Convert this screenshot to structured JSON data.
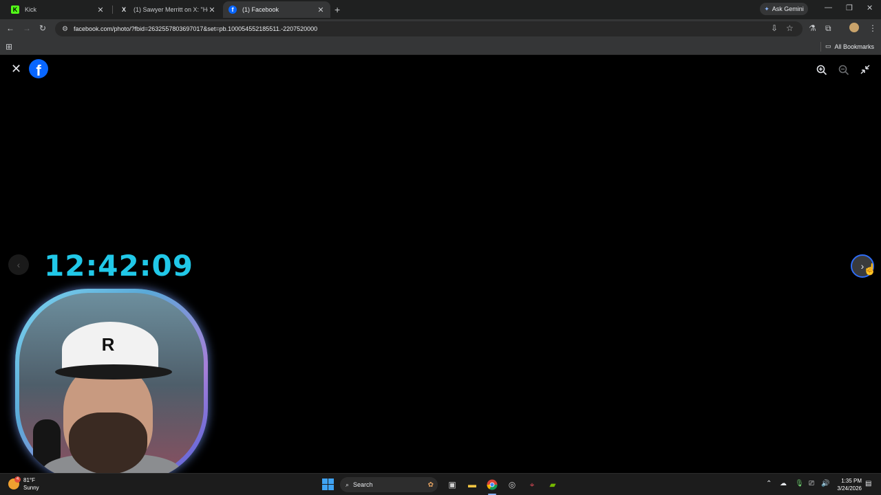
{
  "browser": {
    "tabs": [
      {
        "title": "Kick",
        "favicon": "K",
        "color": "#53fc18",
        "active": false
      },
      {
        "title": "(1) Sawyer Merritt on X: \"Holy m",
        "favicon": "X",
        "color": "#e8eaed",
        "active": false
      },
      {
        "title": "(1) Facebook",
        "favicon": "f",
        "color": "#0866ff",
        "active": true
      }
    ],
    "ask_gemini": "Ask Gemini",
    "url": "facebook.com/photo/?fbid=2632557803697017&set=pb.100054552185511.-2207520000",
    "all_bookmarks": "All Bookmarks"
  },
  "viewer": {
    "brand_letter": "f",
    "brand_color": "#0866ff",
    "icons": [
      "close-icon",
      "zoom-in-icon",
      "zoom-out-icon",
      "exit-fullscreen-icon",
      "chevron-left-icon",
      "chevron-right-icon"
    ]
  },
  "overlay": {
    "clock": "12:42:09",
    "webcam_cap_letter": "R"
  },
  "taskbar": {
    "temperature": "81°F",
    "condition": "Sunny",
    "weather_badge": "4",
    "search_placeholder": "Search",
    "time": "1:35 PM",
    "date": "3/24/2026"
  }
}
